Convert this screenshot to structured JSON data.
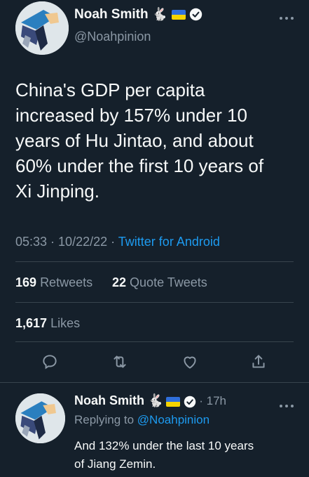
{
  "main_tweet": {
    "author_name": "Noah Smith",
    "author_handle": "@Noahpinion",
    "rabbit_emoji": "🐇",
    "text_lines": [
      "China's GDP per capita",
      "increased by 157% under 10",
      "years of Hu Jintao, and about",
      "60% under the first 10 years of",
      "Xi Jinping."
    ],
    "time": "05:33",
    "separator": " · ",
    "date": "10/22/22",
    "source": "Twitter for Android",
    "retweets_count": "169",
    "retweets_label": "Retweets",
    "quotes_count": "22",
    "quotes_label": "Quote Tweets",
    "likes_count": "1,617",
    "likes_label": "Likes",
    "more_icon": "more-horizontal-icon"
  },
  "actions": [
    "reply-icon",
    "retweet-icon",
    "like-icon",
    "share-icon"
  ],
  "reply_tweet": {
    "author_name": "Noah Smith",
    "rabbit_emoji": "🐇",
    "time_ago": "17h",
    "replying_prefix": "Replying to",
    "replying_handle": "@Noahpinion",
    "text_lines": [
      "And 132% under the last 10 years",
      "of Jiang Zemin."
    ]
  },
  "colors": {
    "background": "#15202b",
    "text": "#f7f9f9",
    "secondary": "#8b98a5",
    "accent": "#1d9bf0",
    "divider": "#38444d"
  }
}
